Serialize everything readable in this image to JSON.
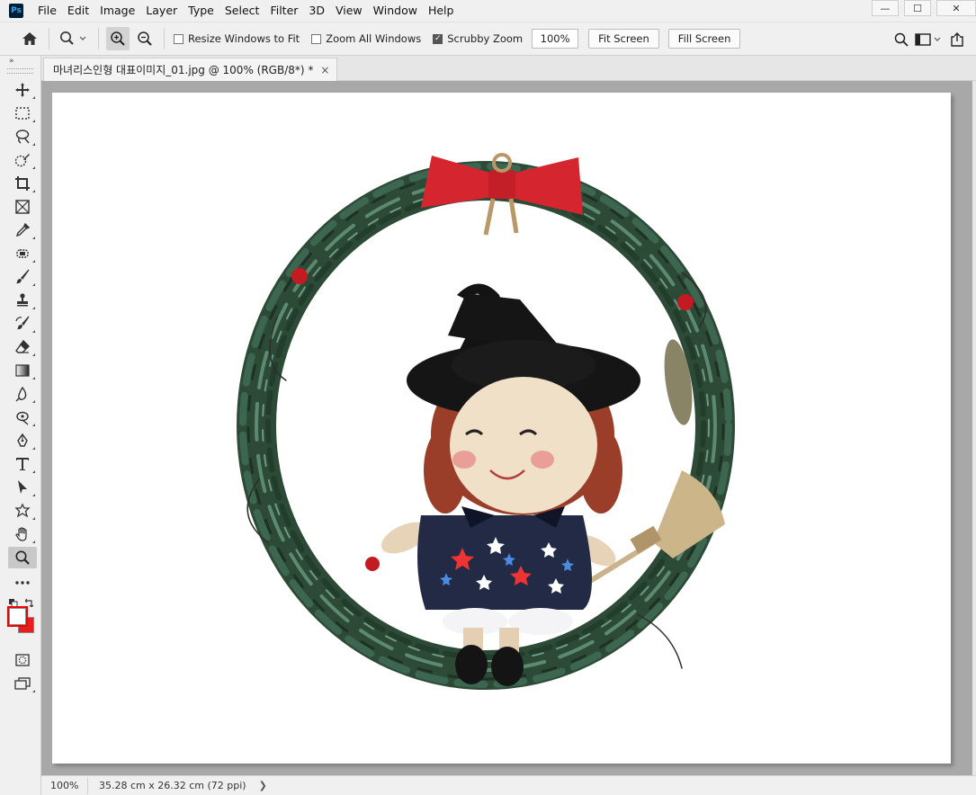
{
  "app": {
    "logo_text": "Ps"
  },
  "menu": [
    "File",
    "Edit",
    "Image",
    "Layer",
    "Type",
    "Select",
    "Filter",
    "3D",
    "View",
    "Window",
    "Help"
  ],
  "window_controls": {
    "minimize": "—",
    "maximize": "☐",
    "close": "✕"
  },
  "options": {
    "resize_windows_label": "Resize Windows to Fit",
    "resize_windows_checked": false,
    "zoom_all_label": "Zoom All Windows",
    "zoom_all_checked": false,
    "scrubby_label": "Scrubby Zoom",
    "scrubby_checked": true,
    "zoom_value": "100%",
    "fit_screen_label": "Fit Screen",
    "fill_screen_label": "Fill Screen"
  },
  "toolbar": {
    "collapse_label": "»"
  },
  "document": {
    "tab_title": "마녀리스인형 대표이미지_01.jpg @ 100% (RGB/8*) *",
    "tab_close": "×"
  },
  "colors": {
    "foreground": "#ffffff",
    "background": "#e81d1d"
  },
  "status": {
    "zoom": "100%",
    "info": "35.28 cm x 26.32 cm (72 ppi)",
    "arrow": "❯"
  }
}
